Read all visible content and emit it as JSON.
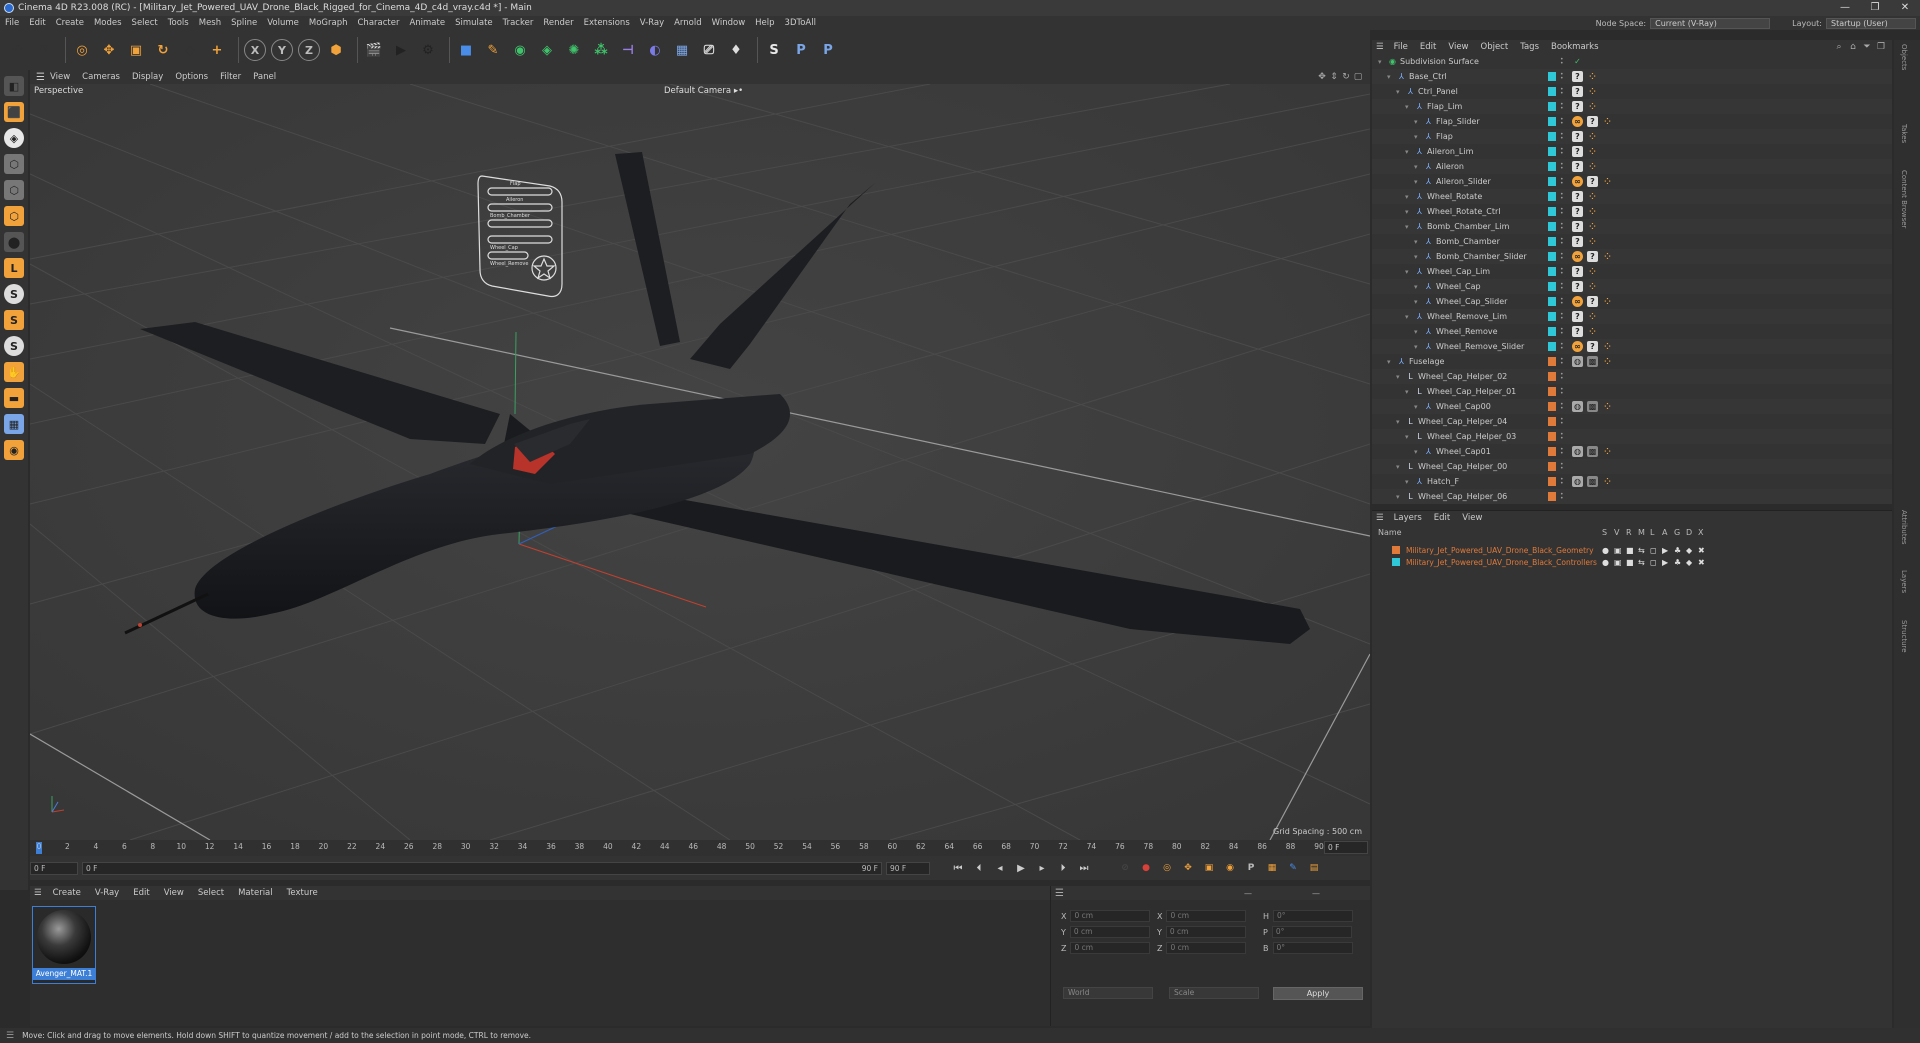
{
  "window": {
    "title": "Cinema 4D R23.008 (RC) - [Military_Jet_Powered_UAV_Drone_Black_Rigged_for_Cinema_4D_c4d_vray.c4d *] - Main",
    "controls": [
      "—",
      "❐",
      "✕"
    ]
  },
  "menubar": {
    "items": [
      "File",
      "Edit",
      "Create",
      "Modes",
      "Select",
      "Tools",
      "Mesh",
      "Spline",
      "Volume",
      "MoGraph",
      "Character",
      "Animate",
      "Simulate",
      "Tracker",
      "Render",
      "Extensions",
      "V-Ray",
      "Arnold",
      "Window",
      "Help",
      "3DToAll"
    ],
    "node_space_label": "Node Space:",
    "node_space_value": "Current (V-Ray)",
    "layout_label": "Layout:",
    "layout_value": "Startup (User)"
  },
  "toolbar": {
    "buttons": [
      {
        "name": "undo-icon",
        "glyph": "↶",
        "color": "#333"
      },
      {
        "name": "redo-icon",
        "glyph": "↷",
        "color": "#333"
      },
      {
        "name": "live-select-icon",
        "glyph": "◎",
        "color": "#f2a23a"
      },
      {
        "name": "move-icon",
        "glyph": "✥",
        "color": "#f2a23a"
      },
      {
        "name": "scale-icon",
        "glyph": "▣",
        "color": "#f2a23a"
      },
      {
        "name": "rotate-icon",
        "glyph": "↻",
        "color": "#f2a23a"
      },
      {
        "name": "last-tool-icon",
        "glyph": "◇",
        "color": "#333"
      },
      {
        "name": "add-icon",
        "glyph": "+",
        "color": "#f2a23a"
      },
      {
        "name": "x-axis-icon",
        "glyph": "X",
        "color": "#bbb"
      },
      {
        "name": "y-axis-icon",
        "glyph": "Y",
        "color": "#bbb"
      },
      {
        "name": "z-axis-icon",
        "glyph": "Z",
        "color": "#bbb"
      },
      {
        "name": "coordinate-system-icon",
        "glyph": "⬢",
        "color": "#f2a23a"
      },
      {
        "name": "render-region-icon",
        "glyph": "🎬",
        "color": "#222"
      },
      {
        "name": "render-view-icon",
        "glyph": "▶",
        "color": "#222"
      },
      {
        "name": "render-settings-icon",
        "glyph": "⚙",
        "color": "#222"
      },
      {
        "name": "cube-icon",
        "glyph": "■",
        "color": "#4a8de8"
      },
      {
        "name": "pen-icon",
        "glyph": "✎",
        "color": "#f2a23a"
      },
      {
        "name": "subdivision-icon",
        "glyph": "◉",
        "color": "#3fc46b"
      },
      {
        "name": "extrude-icon",
        "glyph": "◈",
        "color": "#3fc46b"
      },
      {
        "name": "array-icon",
        "glyph": "✺",
        "color": "#3fc46b"
      },
      {
        "name": "mograph-icon",
        "glyph": "⁂",
        "color": "#3fc46b"
      },
      {
        "name": "deformer-icon",
        "glyph": "⊣",
        "color": "#9b7de8"
      },
      {
        "name": "field-icon",
        "glyph": "◐",
        "color": "#7b7be8"
      },
      {
        "name": "floor-icon",
        "glyph": "▦",
        "color": "#7aa6e8"
      },
      {
        "name": "camera-icon",
        "glyph": "⎚",
        "color": "#ddd"
      },
      {
        "name": "light-icon",
        "glyph": "♦",
        "color": "#ddd"
      },
      {
        "name": "python-icon",
        "glyph": "S",
        "color": "#e8e8e8"
      },
      {
        "name": "python-script-icon",
        "glyph": "P",
        "color": "#7aa6e8"
      },
      {
        "name": "python-generator-icon",
        "glyph": "P",
        "color": "#7aa6e8"
      }
    ]
  },
  "left_tools": [
    {
      "name": "make-editable-icon",
      "glyph": "◧",
      "color": "#555"
    },
    {
      "name": "model-mode-icon",
      "glyph": "⬛",
      "color": "#f2a23a"
    },
    {
      "name": "texture-mode-icon",
      "glyph": "◈",
      "color": "#e8e8e8"
    },
    {
      "name": "points-mode-icon",
      "glyph": "⬡",
      "color": "#777"
    },
    {
      "name": "edges-mode-icon",
      "glyph": "⬡",
      "color": "#777"
    },
    {
      "name": "polygons-mode-icon",
      "glyph": "⬡",
      "color": "#f2a23a"
    },
    {
      "name": "axis-mode-icon",
      "glyph": "⬤",
      "color": "#555"
    },
    {
      "name": "workplane-icon",
      "glyph": "L",
      "color": "#f2a23a"
    },
    {
      "name": "snap-icon",
      "glyph": "S",
      "color": "#ddd"
    },
    {
      "name": "snap-settings-icon",
      "glyph": "S",
      "color": "#f2a23a"
    },
    {
      "name": "quantize-icon",
      "glyph": "S",
      "color": "#ddd"
    },
    {
      "name": "locked-workplane-icon",
      "glyph": "✋",
      "color": "#f2a23a"
    },
    {
      "name": "planar-workplane-icon",
      "glyph": "▬",
      "color": "#f2a23a"
    },
    {
      "name": "grid-icon",
      "glyph": "▦",
      "color": "#7aa6e8"
    },
    {
      "name": "solo-icon",
      "glyph": "◉",
      "color": "#f2a23a"
    }
  ],
  "viewport": {
    "menu": [
      "View",
      "Cameras",
      "Display",
      "Options",
      "Filter",
      "Panel"
    ],
    "label": "Perspective",
    "camera": "Default Camera ▸•",
    "grid_spacing": "Grid Spacing : 500 cm",
    "nav_icons": [
      "move-view-icon",
      "zoom-view-icon",
      "rotate-view-icon",
      "toggle-view-icon"
    ],
    "ctrl_panel_labels": [
      "Flap",
      "Aileron",
      "Bomb_Chamber",
      "Wheel_Cap",
      "Wheel_Remove"
    ]
  },
  "timeline": {
    "ticks": [
      "0",
      "2",
      "4",
      "6",
      "8",
      "10",
      "12",
      "14",
      "16",
      "18",
      "20",
      "22",
      "24",
      "26",
      "28",
      "30",
      "32",
      "34",
      "36",
      "38",
      "40",
      "42",
      "44",
      "46",
      "48",
      "50",
      "52",
      "54",
      "56",
      "58",
      "60",
      "62",
      "64",
      "66",
      "68",
      "70",
      "72",
      "74",
      "76",
      "78",
      "80",
      "82",
      "84",
      "86",
      "88",
      "90"
    ],
    "current_frame": "0 F",
    "start": "0 F",
    "start_field": "0 F",
    "end": "90 F",
    "end_field": "90 F"
  },
  "transport": {
    "buttons": [
      {
        "name": "go-to-start-icon",
        "glyph": "⏮"
      },
      {
        "name": "previous-key-icon",
        "glyph": "⏴"
      },
      {
        "name": "previous-frame-icon",
        "glyph": "◂"
      },
      {
        "name": "play-icon",
        "glyph": "▶"
      },
      {
        "name": "next-frame-icon",
        "glyph": "▸"
      },
      {
        "name": "next-key-icon",
        "glyph": "⏵"
      },
      {
        "name": "go-to-end-icon",
        "glyph": "⏭"
      }
    ],
    "record_buttons": [
      {
        "name": "record-keys-icon",
        "glyph": "⊘",
        "color": "#444"
      },
      {
        "name": "autokey-icon",
        "glyph": "●",
        "color": "#d8413a"
      },
      {
        "name": "keyframe-selection-icon",
        "glyph": "◎",
        "color": "#f2a23a"
      },
      {
        "name": "position-key-icon",
        "glyph": "✥",
        "color": "#f2a23a"
      },
      {
        "name": "scale-key-icon",
        "glyph": "▣",
        "color": "#f2a23a"
      },
      {
        "name": "rotation-key-icon",
        "glyph": "◉",
        "color": "#f2a23a"
      },
      {
        "name": "parameter-key-icon",
        "glyph": "P",
        "color": "#bbb"
      },
      {
        "name": "point-level-icon",
        "glyph": "▦",
        "color": "#f2a23a"
      },
      {
        "name": "schematic-icon",
        "glyph": "✎",
        "color": "#4a8de8"
      },
      {
        "name": "timeline-icon",
        "glyph": "▤",
        "color": "#f2a23a"
      }
    ]
  },
  "materials": {
    "menu": [
      "Create",
      "V-Ray",
      "Edit",
      "View",
      "Select",
      "Material",
      "Texture"
    ],
    "items": [
      {
        "name": "Avenger_MAT.1"
      }
    ]
  },
  "coordinates": {
    "rows": [
      {
        "a": "X",
        "av": "0 cm",
        "b": "X",
        "bv": "0 cm",
        "c": "H",
        "cv": "0°"
      },
      {
        "a": "Y",
        "av": "0 cm",
        "b": "Y",
        "bv": "0 cm",
        "c": "P",
        "cv": "0°"
      },
      {
        "a": "Z",
        "av": "0 cm",
        "b": "Z",
        "bv": "0 cm",
        "c": "B",
        "cv": "0°"
      }
    ],
    "mode_world": "World",
    "mode_scale": "Scale",
    "apply": "Apply"
  },
  "objects": {
    "menu": [
      "File",
      "Edit",
      "View",
      "Object",
      "Tags",
      "Bookmarks"
    ],
    "tree": [
      {
        "label": "Subdivision Surface",
        "depth": 0,
        "icon": "subdivision-icon",
        "layer": "",
        "tags": [
          "chk"
        ]
      },
      {
        "label": "Base_Ctrl",
        "depth": 1,
        "icon": "joint-icon",
        "layer": "#2fc8d8",
        "tags": [
          "q",
          "dot"
        ]
      },
      {
        "label": "Ctrl_Panel",
        "depth": 2,
        "icon": "joint-icon",
        "layer": "#2fc8d8",
        "tags": [
          "q",
          "dot"
        ]
      },
      {
        "label": "Flap_Lim",
        "depth": 3,
        "icon": "joint-icon",
        "layer": "#2fc8d8",
        "tags": [
          "q",
          "dot"
        ]
      },
      {
        "label": "Flap_Slider",
        "depth": 4,
        "icon": "joint-icon",
        "layer": "#2fc8d8",
        "tags": [
          "ik",
          "q",
          "dot"
        ]
      },
      {
        "label": "Flap",
        "depth": 4,
        "icon": "joint-icon",
        "layer": "#2fc8d8",
        "tags": [
          "q",
          "dot"
        ]
      },
      {
        "label": "Aileron_Lim",
        "depth": 3,
        "icon": "joint-icon",
        "layer": "#2fc8d8",
        "tags": [
          "q",
          "dot"
        ]
      },
      {
        "label": "Aileron",
        "depth": 4,
        "icon": "joint-icon",
        "layer": "#2fc8d8",
        "tags": [
          "q",
          "dot"
        ]
      },
      {
        "label": "Aileron_Slider",
        "depth": 4,
        "icon": "joint-icon",
        "layer": "#2fc8d8",
        "tags": [
          "ik",
          "q",
          "dot"
        ]
      },
      {
        "label": "Wheel_Rotate",
        "depth": 3,
        "icon": "joint-icon",
        "layer": "#2fc8d8",
        "tags": [
          "q",
          "dot"
        ]
      },
      {
        "label": "Wheel_Rotate_Ctrl",
        "depth": 3,
        "icon": "joint-icon",
        "layer": "#2fc8d8",
        "tags": [
          "q",
          "dot"
        ]
      },
      {
        "label": "Bomb_Chamber_Lim",
        "depth": 3,
        "icon": "joint-icon",
        "layer": "#2fc8d8",
        "tags": [
          "q",
          "dot"
        ]
      },
      {
        "label": "Bomb_Chamber",
        "depth": 4,
        "icon": "joint-icon",
        "layer": "#2fc8d8",
        "tags": [
          "q",
          "dot"
        ]
      },
      {
        "label": "Bomb_Chamber_Slider",
        "depth": 4,
        "icon": "joint-icon",
        "layer": "#2fc8d8",
        "tags": [
          "ik",
          "q",
          "dot"
        ]
      },
      {
        "label": "Wheel_Cap_Lim",
        "depth": 3,
        "icon": "joint-icon",
        "layer": "#2fc8d8",
        "tags": [
          "q",
          "dot"
        ]
      },
      {
        "label": "Wheel_Cap",
        "depth": 4,
        "icon": "joint-icon",
        "layer": "#2fc8d8",
        "tags": [
          "q",
          "dot"
        ]
      },
      {
        "label": "Wheel_Cap_Slider",
        "depth": 4,
        "icon": "joint-icon",
        "layer": "#2fc8d8",
        "tags": [
          "ik",
          "q",
          "dot"
        ]
      },
      {
        "label": "Wheel_Remove_Lim",
        "depth": 3,
        "icon": "joint-icon",
        "layer": "#2fc8d8",
        "tags": [
          "q",
          "dot"
        ]
      },
      {
        "label": "Wheel_Remove",
        "depth": 4,
        "icon": "joint-icon",
        "layer": "#2fc8d8",
        "tags": [
          "q",
          "dot"
        ]
      },
      {
        "label": "Wheel_Remove_Slider",
        "depth": 4,
        "icon": "joint-icon",
        "layer": "#2fc8d8",
        "tags": [
          "ik",
          "q",
          "dot"
        ]
      },
      {
        "label": "Fuselage",
        "depth": 1,
        "icon": "joint-icon",
        "layer": "#e07a3a",
        "tags": [
          "wire",
          "chk",
          "dot"
        ]
      },
      {
        "label": "Wheel_Cap_Helper_02",
        "depth": 2,
        "icon": "null-icon",
        "layer": "#e07a3a",
        "tags": []
      },
      {
        "label": "Wheel_Cap_Helper_01",
        "depth": 3,
        "icon": "null-icon",
        "layer": "#e07a3a",
        "tags": []
      },
      {
        "label": "Wheel_Cap00",
        "depth": 4,
        "icon": "joint-icon",
        "layer": "#e07a3a",
        "tags": [
          "wire",
          "chk",
          "dot"
        ]
      },
      {
        "label": "Wheel_Cap_Helper_04",
        "depth": 2,
        "icon": "null-icon",
        "layer": "#e07a3a",
        "tags": []
      },
      {
        "label": "Wheel_Cap_Helper_03",
        "depth": 3,
        "icon": "null-icon",
        "layer": "#e07a3a",
        "tags": []
      },
      {
        "label": "Wheel_Cap01",
        "depth": 4,
        "icon": "joint-icon",
        "layer": "#e07a3a",
        "tags": [
          "wire",
          "chk",
          "dot"
        ]
      },
      {
        "label": "Wheel_Cap_Helper_00",
        "depth": 2,
        "icon": "null-icon",
        "layer": "#e07a3a",
        "tags": []
      },
      {
        "label": "Hatch_F",
        "depth": 3,
        "icon": "joint-icon",
        "layer": "#e07a3a",
        "tags": [
          "wire",
          "chk",
          "dot"
        ]
      },
      {
        "label": "Wheel_Cap_Helper_06",
        "depth": 2,
        "icon": "null-icon",
        "layer": "#e07a3a",
        "tags": []
      }
    ]
  },
  "layers": {
    "menu": [
      "Layers",
      "Edit",
      "View"
    ],
    "header": {
      "name": "Name",
      "flags": [
        "S",
        "V",
        "R",
        "M",
        "L",
        "A",
        "G",
        "D",
        "X"
      ]
    },
    "items": [
      {
        "name": "Military_Jet_Powered_UAV_Drone_Black_Geometry",
        "color": "#e07a3a",
        "text_color": "#e07a3a"
      },
      {
        "name": "Military_Jet_Powered_UAV_Drone_Black_Controllers",
        "color": "#2fc8d8",
        "text_color": "#e07a3a"
      }
    ]
  },
  "right_tabs": [
    "Objects",
    "Takes",
    "Content Browser",
    "Attributes",
    "Layers",
    "Structure"
  ],
  "status": {
    "text": "Move: Click and drag to move elements. Hold down SHIFT to quantize movement / add to the selection in point mode, CTRL to remove."
  }
}
